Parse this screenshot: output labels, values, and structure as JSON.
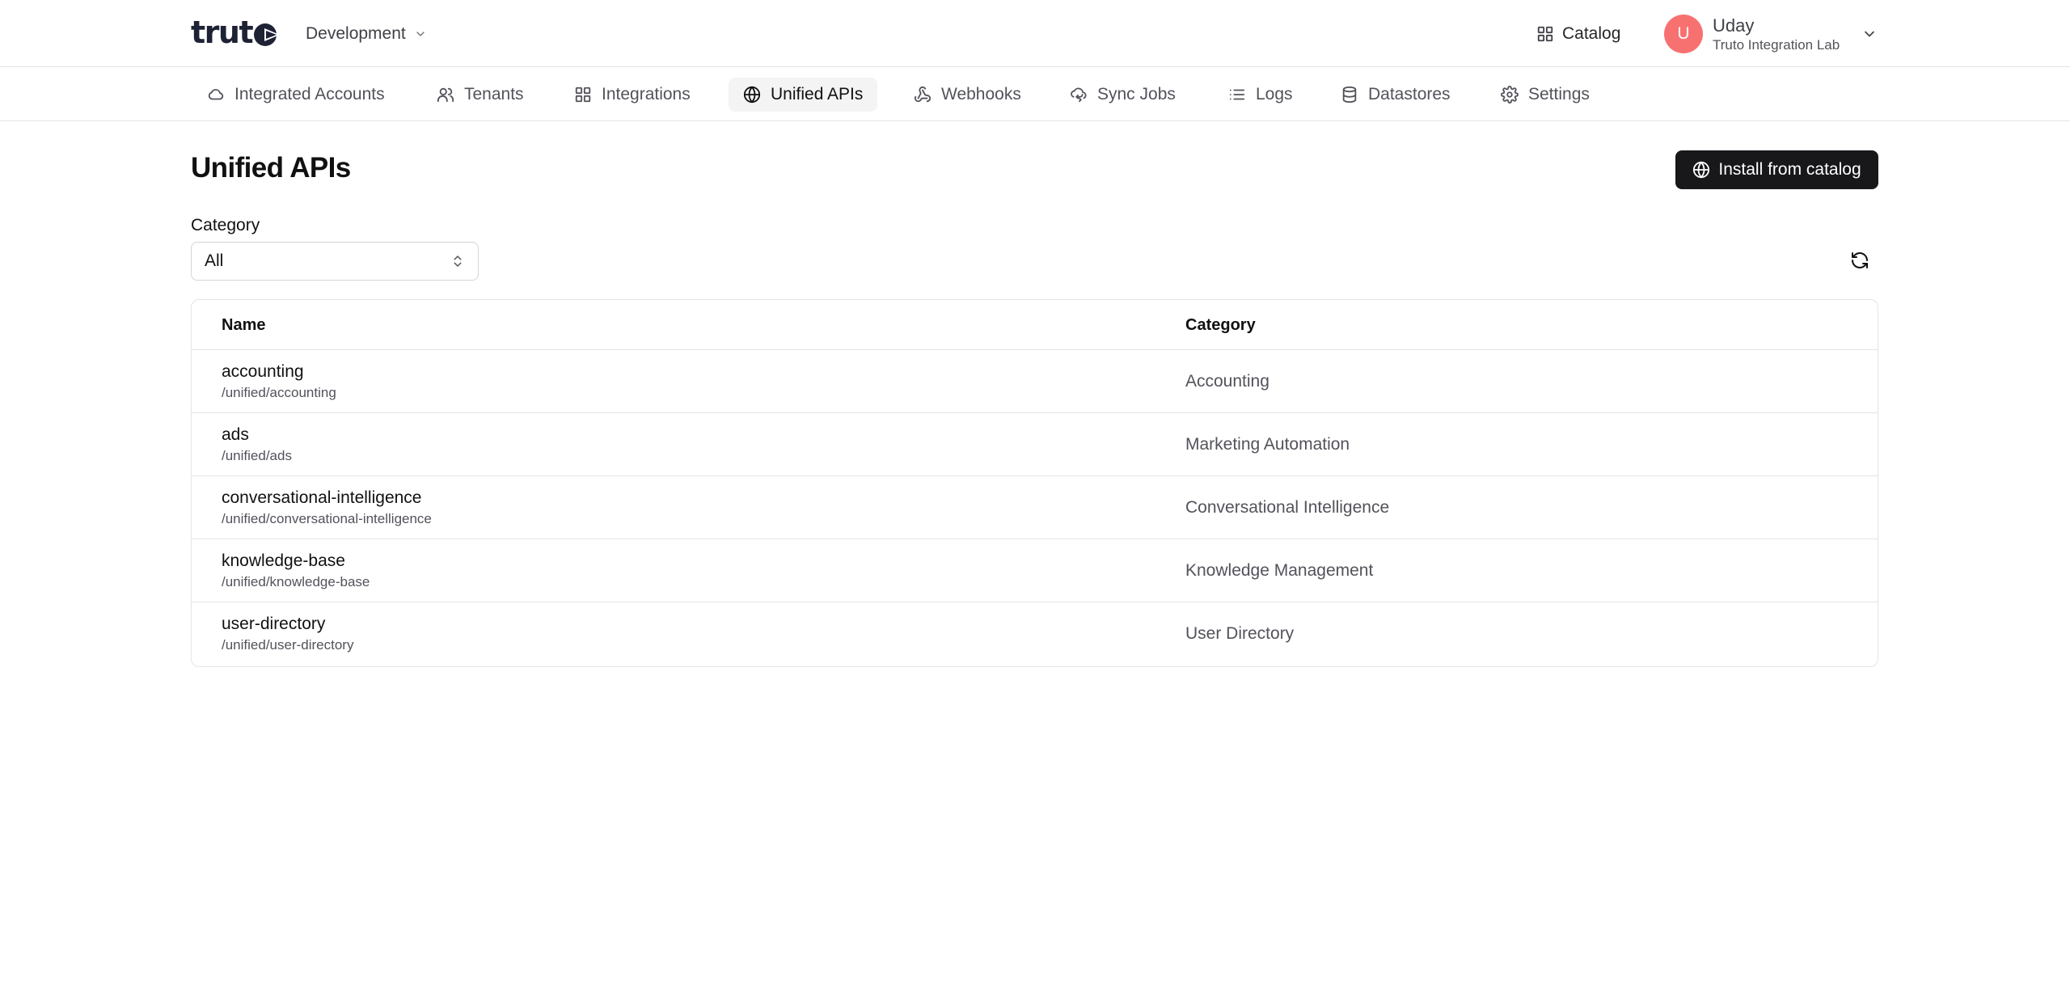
{
  "header": {
    "logo_text": "trut",
    "environment": "Development",
    "catalog_label": "Catalog",
    "user": {
      "initial": "U",
      "name": "Uday",
      "org": "Truto Integration Lab"
    }
  },
  "nav": {
    "tabs": [
      {
        "label": "Integrated Accounts",
        "icon": "cloud-icon"
      },
      {
        "label": "Tenants",
        "icon": "users-icon"
      },
      {
        "label": "Integrations",
        "icon": "grid-icon"
      },
      {
        "label": "Unified APIs",
        "icon": "globe-icon",
        "active": true
      },
      {
        "label": "Webhooks",
        "icon": "webhook-icon"
      },
      {
        "label": "Sync Jobs",
        "icon": "cloud-sync-icon"
      },
      {
        "label": "Logs",
        "icon": "list-icon"
      },
      {
        "label": "Datastores",
        "icon": "database-icon"
      },
      {
        "label": "Settings",
        "icon": "gear-icon"
      }
    ]
  },
  "page": {
    "title": "Unified APIs",
    "install_button": "Install from catalog",
    "filter": {
      "label": "Category",
      "value": "All"
    }
  },
  "table": {
    "headers": {
      "name": "Name",
      "category": "Category"
    },
    "rows": [
      {
        "name": "accounting",
        "path": "/unified/accounting",
        "category": "Accounting"
      },
      {
        "name": "ads",
        "path": "/unified/ads",
        "category": "Marketing Automation"
      },
      {
        "name": "conversational-intelligence",
        "path": "/unified/conversational-intelligence",
        "category": "Conversational Intelligence"
      },
      {
        "name": "knowledge-base",
        "path": "/unified/knowledge-base",
        "category": "Knowledge Management"
      },
      {
        "name": "user-directory",
        "path": "/unified/user-directory",
        "category": "User Directory"
      }
    ]
  },
  "colors": {
    "primary_button": "#18181b",
    "avatar": "#f87171",
    "border": "#e4e4e7",
    "muted_text": "#52525b"
  }
}
